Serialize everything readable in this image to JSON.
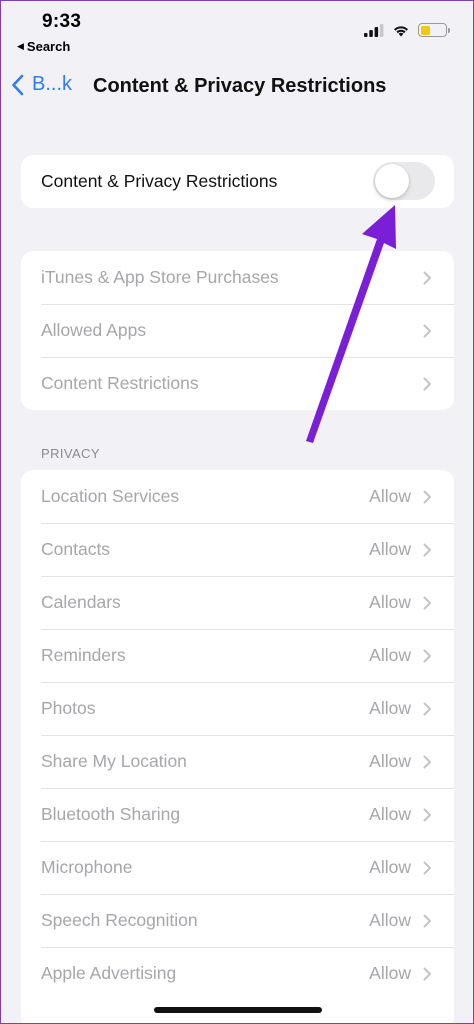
{
  "status_bar": {
    "time": "9:33",
    "back_app": "Search",
    "battery_color": "#f5c518"
  },
  "nav": {
    "back_label": "B...k",
    "title": "Content & Privacy Restrictions"
  },
  "main_toggle": {
    "label": "Content & Privacy Restrictions",
    "enabled": false
  },
  "store_group": [
    {
      "label": "iTunes & App Store Purchases"
    },
    {
      "label": "Allowed Apps"
    },
    {
      "label": "Content Restrictions"
    }
  ],
  "privacy": {
    "header": "PRIVACY",
    "items": [
      {
        "label": "Location Services",
        "value": "Allow"
      },
      {
        "label": "Contacts",
        "value": "Allow"
      },
      {
        "label": "Calendars",
        "value": "Allow"
      },
      {
        "label": "Reminders",
        "value": "Allow"
      },
      {
        "label": "Photos",
        "value": "Allow"
      },
      {
        "label": "Share My Location",
        "value": "Allow"
      },
      {
        "label": "Bluetooth Sharing",
        "value": "Allow"
      },
      {
        "label": "Microphone",
        "value": "Allow"
      },
      {
        "label": "Speech Recognition",
        "value": "Allow"
      },
      {
        "label": "Apple Advertising",
        "value": "Allow"
      }
    ]
  },
  "colors": {
    "accent": "#2f7cf6",
    "annotation_arrow": "#7a1fd6"
  }
}
